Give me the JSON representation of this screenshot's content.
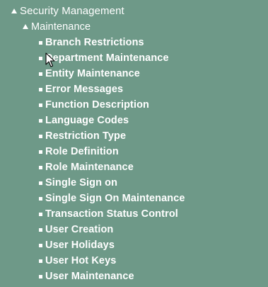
{
  "tree": {
    "root": {
      "label": "Security Management",
      "icon": "collapse-triangle-icon"
    },
    "group": {
      "label": "Maintenance",
      "icon": "collapse-triangle-icon"
    },
    "items": [
      {
        "label": "Branch Restrictions"
      },
      {
        "label": "Department Maintenance"
      },
      {
        "label": "Entity Maintenance"
      },
      {
        "label": "Error Messages"
      },
      {
        "label": "Function Description"
      },
      {
        "label": "Language Codes"
      },
      {
        "label": "Restriction Type"
      },
      {
        "label": "Role Definition"
      },
      {
        "label": "Role Maintenance"
      },
      {
        "label": "Single Sign on"
      },
      {
        "label": "Single Sign On Maintenance"
      },
      {
        "label": "Transaction Status Control"
      },
      {
        "label": "User Creation"
      },
      {
        "label": "User Holidays"
      },
      {
        "label": "User Hot Keys"
      },
      {
        "label": "User Maintenance"
      }
    ]
  },
  "colors": {
    "background": "#6e9988",
    "text": "#ffffff"
  },
  "cursor": {
    "icon": "mouse-pointer-icon"
  }
}
